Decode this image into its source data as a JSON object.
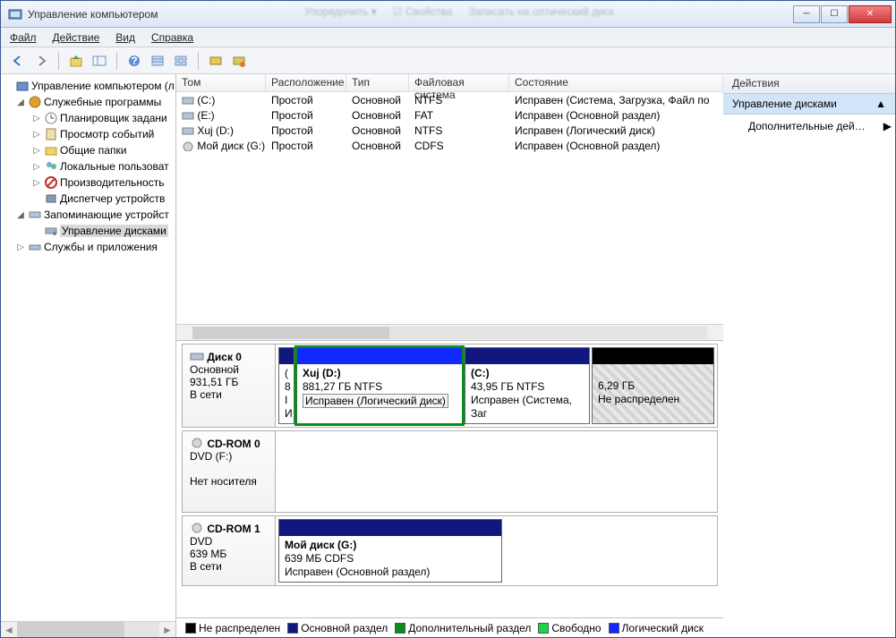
{
  "title": "Управление компьютером",
  "menu": {
    "file": "Файл",
    "action": "Действие",
    "view": "Вид",
    "help": "Справка"
  },
  "tree": {
    "root": "Управление компьютером (л",
    "sys": "Служебные программы",
    "sched": "Планировщик задани",
    "events": "Просмотр событий",
    "shared": "Общие папки",
    "users": "Локальные пользоват",
    "perf": "Производительность",
    "devmgr": "Диспетчер устройств",
    "storage": "Запоминающие устройст",
    "diskmgmt": "Управление дисками",
    "services": "Службы и приложения"
  },
  "columns": {
    "vol": "Том",
    "layout": "Расположение",
    "type": "Тип",
    "fs": "Файловая система",
    "status": "Состояние"
  },
  "volumes": [
    {
      "name": "(C:)",
      "layout": "Простой",
      "type": "Основной",
      "fs": "NTFS",
      "status": "Исправен (Система, Загрузка, Файл по"
    },
    {
      "name": "(E:)",
      "layout": "Простой",
      "type": "Основной",
      "fs": "FAT",
      "status": "Исправен (Основной раздел)"
    },
    {
      "name": "Xuj (D:)",
      "layout": "Простой",
      "type": "Основной",
      "fs": "NTFS",
      "status": "Исправен (Логический диск)"
    },
    {
      "name": "Мой диск (G:)",
      "layout": "Простой",
      "type": "Основной",
      "fs": "CDFS",
      "status": "Исправен (Основной раздел)"
    }
  ],
  "disk0": {
    "title": "Диск 0",
    "type": "Основной",
    "size": "931,51 ГБ",
    "state": "В сети",
    "p0": {
      "l1": "(",
      "l2": "8 I",
      "l3": "И"
    },
    "p1": {
      "name": "Xuj  (D:)",
      "size": "881,27 ГБ NTFS",
      "status": "Исправен (Логический диск)"
    },
    "p2": {
      "name": "(C:)",
      "size": "43,95 ГБ NTFS",
      "status": "Исправен (Система, Заг"
    },
    "p3": {
      "size": "6,29 ГБ",
      "status": "Не распределен"
    }
  },
  "cdrom0": {
    "title": "CD-ROM 0",
    "type": "DVD (F:)",
    "state": "Нет носителя"
  },
  "cdrom1": {
    "title": "CD-ROM 1",
    "type": "DVD",
    "size": "639 МБ",
    "state": "В сети",
    "p": {
      "name": "Мой диск  (G:)",
      "size": "639 МБ CDFS",
      "status": "Исправен (Основной раздел)"
    }
  },
  "legend": {
    "unalloc": "Не распределен",
    "primary": "Основной раздел",
    "extended": "Дополнительный раздел",
    "free": "Свободно",
    "logical": "Логический диск"
  },
  "actions": {
    "head": "Действия",
    "sub": "Управление дисками",
    "more": "Дополнительные дей…"
  }
}
